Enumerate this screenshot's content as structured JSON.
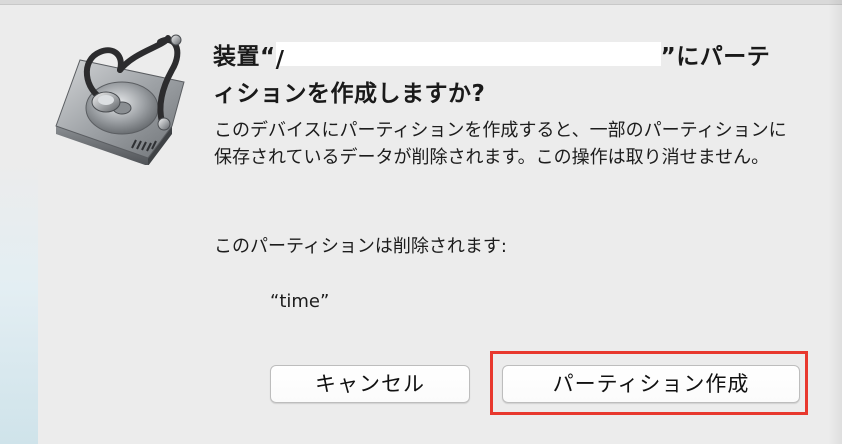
{
  "dialog": {
    "title_prefix": "装置“",
    "title_redacted_marker": "/",
    "title_suffix_line1": "”にパーテ",
    "title_line2": "ィションを作成しますか?",
    "body": "このデバイスにパーティションを作成すると、一部のパーティションに保存されているデータが削除されます。この操作は取り消せません。",
    "removed_label": "このパーティションは削除されます:",
    "partition_name": "“time”"
  },
  "buttons": {
    "cancel_label": "キャンセル",
    "partition_label": "パーティション作成"
  },
  "icons": {
    "app_icon": "disk-utility-icon"
  },
  "colors": {
    "background": "#ececec",
    "highlight": "#e8382e",
    "button_bg": "#ffffff"
  }
}
